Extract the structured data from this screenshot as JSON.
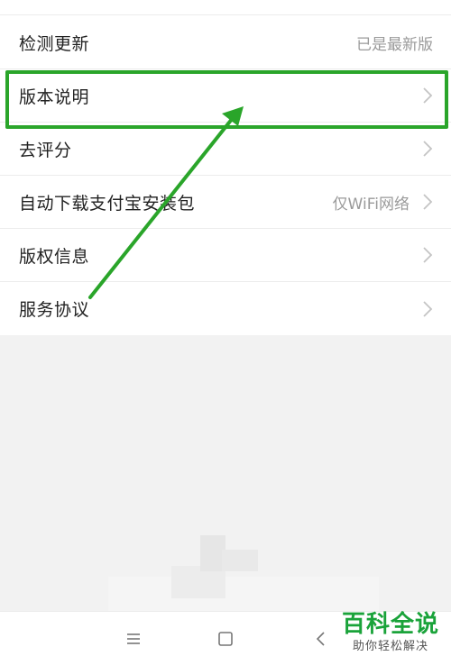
{
  "settings": {
    "items": [
      {
        "label": "检测更新",
        "value": "已是最新版",
        "arrow": false
      },
      {
        "label": "版本说明",
        "value": "",
        "arrow": true
      },
      {
        "label": "去评分",
        "value": "",
        "arrow": true
      },
      {
        "label": "自动下载支付宝安装包",
        "value": "仅WiFi网络",
        "arrow": true
      },
      {
        "label": "版权信息",
        "value": "",
        "arrow": true
      },
      {
        "label": "服务协议",
        "value": "",
        "arrow": true
      }
    ]
  },
  "annotation": {
    "highlight_color": "#2aa52a",
    "highlighted_item": "版本说明"
  },
  "navbar": {
    "icons": [
      "menu-icon",
      "home-icon",
      "back-icon"
    ]
  },
  "watermark": {
    "title": "百科全说",
    "subtitle": "助你轻松解决"
  },
  "colors": {
    "background": "#f2f2f2",
    "list_background": "#ffffff",
    "label_text": "#222222",
    "value_text": "#9a9a9a",
    "watermark_green": "#1aa33a"
  }
}
